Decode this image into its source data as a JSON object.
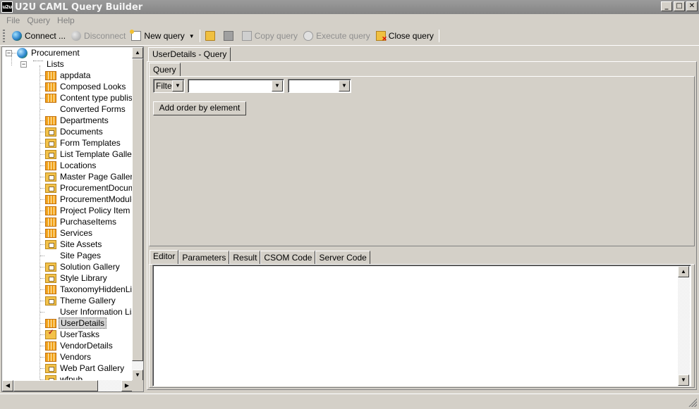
{
  "window": {
    "app_icon_text": "u2u",
    "title": "U2U CAML Query Builder",
    "minimize": "_",
    "maximize": "□",
    "close": "✕"
  },
  "menu": [
    "File",
    "Query",
    "Help"
  ],
  "toolbar": {
    "connect": "Connect ...",
    "disconnect": "Disconnect",
    "new_query": "New query",
    "copy_query": "Copy query",
    "execute_query": "Execute query",
    "close_query": "Close query"
  },
  "tree": {
    "root": "Procurement",
    "lists_node": "Lists",
    "selected": "UserDetails",
    "items": [
      {
        "label": "appdata",
        "icon": "list-icon"
      },
      {
        "label": "Composed Looks",
        "icon": "list-icon"
      },
      {
        "label": "Content type publishing",
        "icon": "list-icon"
      },
      {
        "label": "Converted Forms",
        "icon": "none"
      },
      {
        "label": "Departments",
        "icon": "list-icon"
      },
      {
        "label": "Documents",
        "icon": "library-icon"
      },
      {
        "label": "Form Templates",
        "icon": "library-icon"
      },
      {
        "label": "List Template Gallery",
        "icon": "library-icon"
      },
      {
        "label": "Locations",
        "icon": "list-icon"
      },
      {
        "label": "Master Page Gallery",
        "icon": "library-icon"
      },
      {
        "label": "ProcurementDocumen",
        "icon": "library-icon"
      },
      {
        "label": "ProcurementModuleEx",
        "icon": "list-icon"
      },
      {
        "label": "Project Policy Item List",
        "icon": "list-icon"
      },
      {
        "label": "PurchaseItems",
        "icon": "list-icon"
      },
      {
        "label": "Services",
        "icon": "list-icon"
      },
      {
        "label": "Site Assets",
        "icon": "library-icon"
      },
      {
        "label": "Site Pages",
        "icon": "none"
      },
      {
        "label": "Solution Gallery",
        "icon": "library-icon"
      },
      {
        "label": "Style Library",
        "icon": "library-icon"
      },
      {
        "label": "TaxonomyHiddenList",
        "icon": "list-icon"
      },
      {
        "label": "Theme Gallery",
        "icon": "library-icon"
      },
      {
        "label": "User Information List",
        "icon": "none"
      },
      {
        "label": "UserDetails",
        "icon": "list-icon"
      },
      {
        "label": "UserTasks",
        "icon": "task-icon"
      },
      {
        "label": "VendorDetails",
        "icon": "list-icon"
      },
      {
        "label": "Vendors",
        "icon": "list-icon"
      },
      {
        "label": "Web Part Gallery",
        "icon": "library-icon"
      },
      {
        "label": "wfpub",
        "icon": "library-icon"
      }
    ]
  },
  "document_tab": "UserDetails - Query",
  "query_tab": "Query",
  "query": {
    "filter_value": "Filter",
    "field_value": "",
    "operator_value": "",
    "add_order_button": "Add order by element"
  },
  "bottom_tabs": [
    "Editor",
    "Parameters",
    "Result",
    "CSOM Code",
    "Server Code"
  ],
  "editor_content": ""
}
